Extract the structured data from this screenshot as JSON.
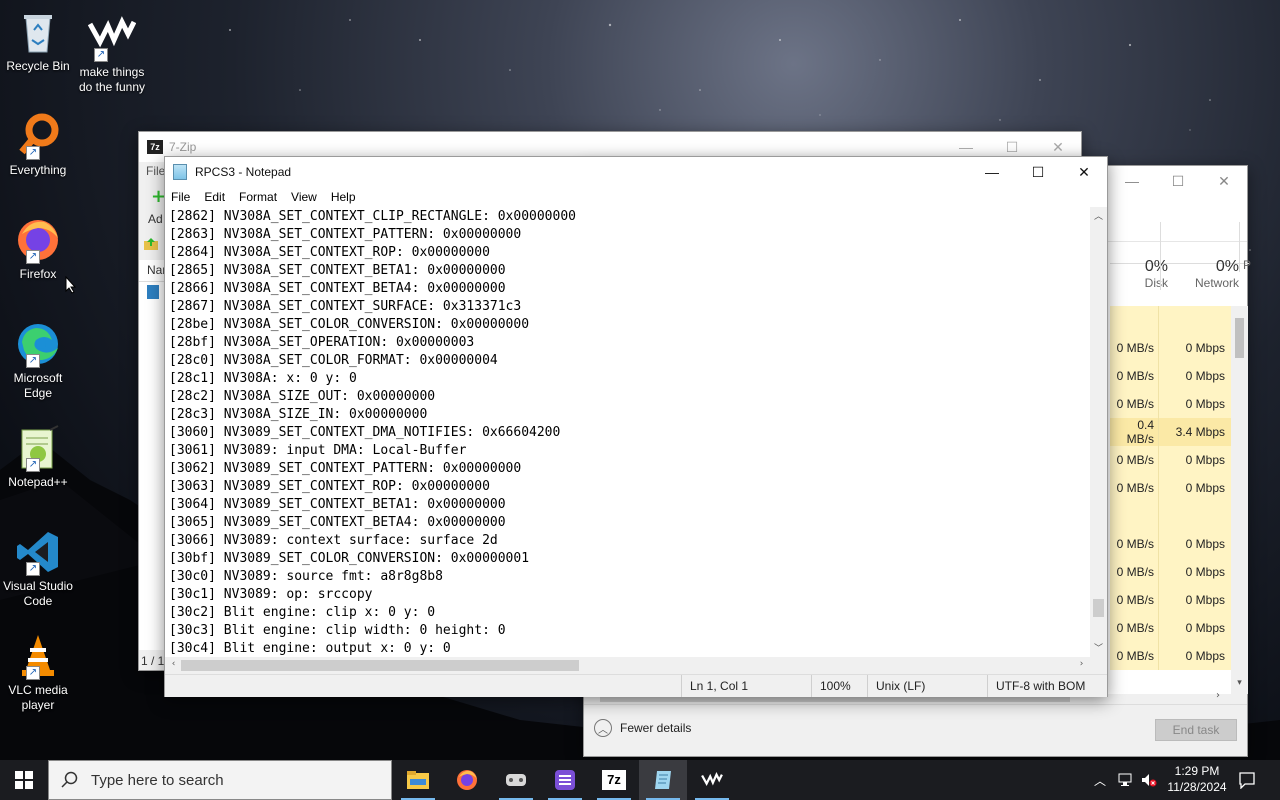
{
  "desktop": {
    "icons": [
      {
        "label": "Recycle Bin",
        "icon": "recycle-bin-icon"
      },
      {
        "label": "make things do the funny",
        "icon": "app-logo-icon"
      },
      {
        "label": "Everything",
        "icon": "everything-search-icon"
      },
      {
        "label": "Firefox",
        "icon": "firefox-icon"
      },
      {
        "label": "Microsoft Edge",
        "icon": "edge-icon"
      },
      {
        "label": "Notepad++",
        "icon": "notepadpp-icon"
      },
      {
        "label": "Visual Studio Code",
        "icon": "vscode-icon"
      },
      {
        "label": "VLC media player",
        "icon": "vlc-icon"
      }
    ]
  },
  "zip": {
    "title": "7-Zip",
    "menu_partial": "File",
    "toolbar_partial": "Ad",
    "col_partial": "Nar",
    "status_partial": "1 / 1"
  },
  "taskmgr": {
    "columns": [
      {
        "pct": "0%",
        "label": "Disk"
      },
      {
        "pct": "0%",
        "label": "Network"
      },
      {
        "pct": "",
        "label": "P"
      }
    ],
    "rows": [
      {
        "disk": "",
        "net": ""
      },
      {
        "disk": "0 MB/s",
        "net": "0 Mbps"
      },
      {
        "disk": "0 MB/s",
        "net": "0 Mbps"
      },
      {
        "disk": "0 MB/s",
        "net": "0 Mbps"
      },
      {
        "disk": "0.4 MB/s",
        "net": "3.4 Mbps"
      },
      {
        "disk": "0 MB/s",
        "net": "0 Mbps"
      },
      {
        "disk": "0 MB/s",
        "net": "0 Mbps"
      },
      {
        "disk": "",
        "net": ""
      },
      {
        "disk": "0 MB/s",
        "net": "0 Mbps"
      },
      {
        "disk": "0 MB/s",
        "net": "0 Mbps"
      },
      {
        "disk": "0 MB/s",
        "net": "0 Mbps"
      },
      {
        "disk": "0 MB/s",
        "net": "0 Mbps"
      },
      {
        "disk": "0 MB/s",
        "net": "0 Mbps"
      }
    ],
    "fewer_details": "Fewer details",
    "end_task": "End task"
  },
  "notepad": {
    "title": "RPCS3 - Notepad",
    "menu": [
      "File",
      "Edit",
      "Format",
      "View",
      "Help"
    ],
    "lines": [
      "[2862] NV308A_SET_CONTEXT_CLIP_RECTANGLE: 0x00000000",
      "[2863] NV308A_SET_CONTEXT_PATTERN: 0x00000000",
      "[2864] NV308A_SET_CONTEXT_ROP: 0x00000000",
      "[2865] NV308A_SET_CONTEXT_BETA1: 0x00000000",
      "[2866] NV308A_SET_CONTEXT_BETA4: 0x00000000",
      "[2867] NV308A_SET_CONTEXT_SURFACE: 0x313371c3",
      "[28be] NV308A_SET_COLOR_CONVERSION: 0x00000000",
      "[28bf] NV308A_SET_OPERATION: 0x00000003",
      "[28c0] NV308A_SET_COLOR_FORMAT: 0x00000004",
      "[28c1] NV308A: x: 0 y: 0",
      "[28c2] NV308A_SIZE_OUT: 0x00000000",
      "[28c3] NV308A_SIZE_IN: 0x00000000",
      "[3060] NV3089_SET_CONTEXT_DMA_NOTIFIES: 0x66604200",
      "[3061] NV3089: input DMA: Local-Buffer",
      "[3062] NV3089_SET_CONTEXT_PATTERN: 0x00000000",
      "[3063] NV3089_SET_CONTEXT_ROP: 0x00000000",
      "[3064] NV3089_SET_CONTEXT_BETA1: 0x00000000",
      "[3065] NV3089_SET_CONTEXT_BETA4: 0x00000000",
      "[3066] NV3089: context surface: surface 2d",
      "[30bf] NV3089_SET_COLOR_CONVERSION: 0x00000001",
      "[30c0] NV3089: source fmt: a8r8g8b8",
      "[30c1] NV3089: op: srccopy",
      "[30c2] Blit engine: clip x: 0 y: 0",
      "[30c3] Blit engine: clip width: 0 height: 0",
      "[30c4] Blit engine: output x: 0 y: 0"
    ],
    "status": {
      "position": "Ln 1, Col 1",
      "zoom": "100%",
      "line_ending": "Unix (LF)",
      "encoding": "UTF-8 with BOM"
    }
  },
  "taskbar": {
    "search_placeholder": "Type here to search",
    "apps": [
      "file-explorer-icon",
      "firefox-icon",
      "rpcs3-icon",
      "app-icon",
      "7zip-icon",
      "notepad-icon",
      "app-logo-icon"
    ],
    "zip_label": "7z",
    "time": "1:29 PM",
    "date": "11/28/2024"
  }
}
